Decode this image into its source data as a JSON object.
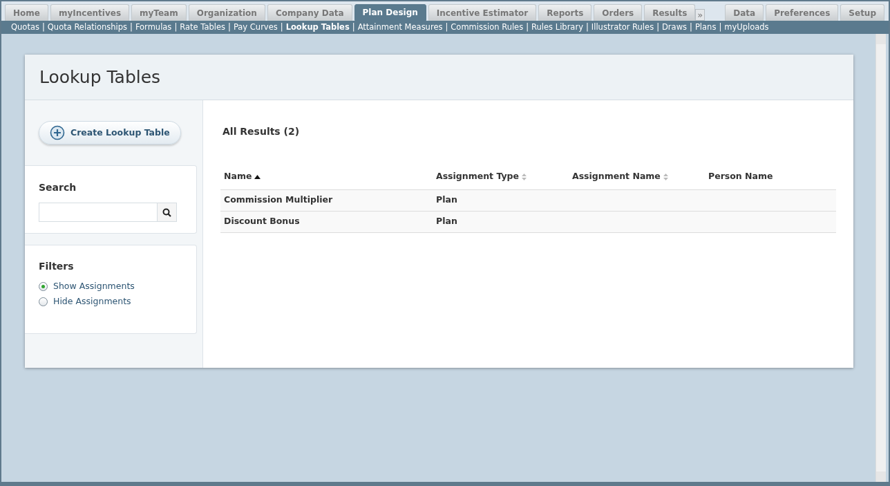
{
  "top_tabs": [
    {
      "label": "Home",
      "selected": false
    },
    {
      "label": "myIncentives",
      "selected": false
    },
    {
      "label": "myTeam",
      "selected": false
    },
    {
      "label": "Organization",
      "selected": false
    },
    {
      "label": "Company Data",
      "selected": false
    },
    {
      "label": "Plan Design",
      "selected": true
    },
    {
      "label": "Incentive Estimator",
      "selected": false
    },
    {
      "label": "Reports",
      "selected": false
    },
    {
      "label": "Orders",
      "selected": false
    },
    {
      "label": "Results",
      "selected": false
    }
  ],
  "more_tabs": "»",
  "right_tabs": [
    {
      "label": "Data",
      "selected": false
    },
    {
      "label": "Preferences",
      "selected": false
    },
    {
      "label": "Setup",
      "selected": false
    }
  ],
  "subnav": {
    "separator": "|",
    "links": [
      {
        "label": "Quotas",
        "selected": false
      },
      {
        "label": "Quota Relationships",
        "selected": false
      },
      {
        "label": "Formulas",
        "selected": false
      },
      {
        "label": "Rate Tables",
        "selected": false
      },
      {
        "label": "Pay Curves",
        "selected": false
      },
      {
        "label": "Lookup Tables",
        "selected": true
      },
      {
        "label": "Attainment Measures",
        "selected": false
      },
      {
        "label": "Commission Rules",
        "selected": false
      },
      {
        "label": "Rules Library",
        "selected": false
      },
      {
        "label": "Illustrator Rules",
        "selected": false
      },
      {
        "label": "Draws",
        "selected": false
      },
      {
        "label": "Plans",
        "selected": false
      },
      {
        "label": "myUploads",
        "selected": false
      }
    ]
  },
  "page_title": "Lookup Tables",
  "create_button": "Create Lookup Table",
  "search": {
    "title": "Search"
  },
  "filters": {
    "title": "Filters",
    "options": [
      {
        "label": "Show Assignments",
        "selected": true
      },
      {
        "label": "Hide Assignments",
        "selected": false
      }
    ]
  },
  "results_title": "All Results (2)",
  "table": {
    "columns": [
      {
        "label": "Name",
        "sorted": true
      },
      {
        "label": "Assignment Type",
        "sortable": true,
        "sorted": false
      },
      {
        "label": "Assignment Name",
        "sortable": true,
        "sorted": false
      },
      {
        "label": "Person Name",
        "sortable": false
      }
    ],
    "rows": [
      [
        "Commission Multiplier",
        "Plan"
      ],
      [
        "Discount Bonus",
        "Plan"
      ]
    ]
  }
}
